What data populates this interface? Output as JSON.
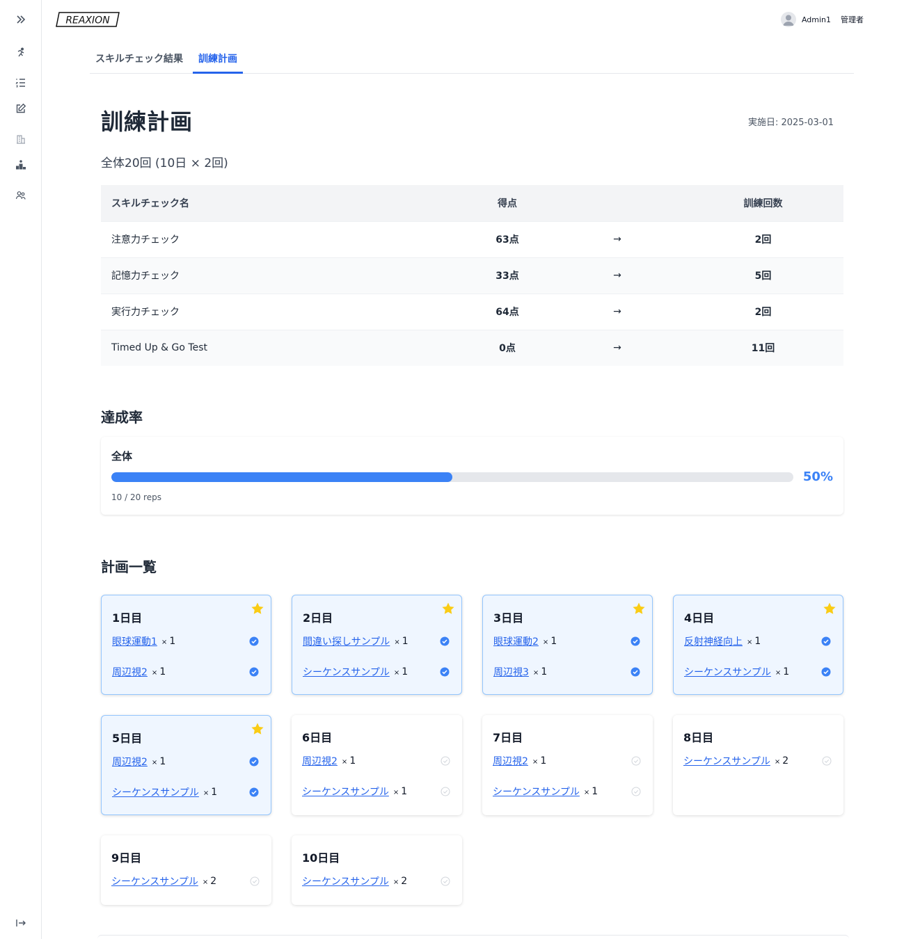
{
  "app": {
    "logo_text": "REAXION",
    "user": {
      "name": "Admin1",
      "role": "管理者"
    }
  },
  "sidebar": {
    "icons": [
      "expand-icon",
      "runner-icon",
      "list-icon",
      "edit-icon",
      "building-icon",
      "podium-icon",
      "users-icon",
      "logout-icon"
    ]
  },
  "tabs": [
    {
      "label": "スキルチェック結果",
      "active": false
    },
    {
      "label": "訓練計画",
      "active": true
    }
  ],
  "page": {
    "title": "訓練計画",
    "exec_date": "実施日: 2025-03-01",
    "summary": "全体20回 (10日 × 2回)"
  },
  "score_table": {
    "headers": {
      "name": "スキルチェック名",
      "score": "得点",
      "count": "訓練回数"
    },
    "arrow": "→",
    "rows": [
      {
        "name": "注意力チェック",
        "score": "63点",
        "count": "2回"
      },
      {
        "name": "記憶力チェック",
        "score": "33点",
        "count": "5回"
      },
      {
        "name": "実行力チェック",
        "score": "64点",
        "count": "2回"
      },
      {
        "name": "Timed Up & Go Test",
        "score": "0点",
        "count": "11回"
      }
    ]
  },
  "achievement": {
    "section_title": "達成率",
    "label": "全体",
    "percent_text": "50%",
    "fraction": 0.5,
    "reps": "10 / 20 reps"
  },
  "plan": {
    "section_title": "計画一覧",
    "days": [
      {
        "title": "1日目",
        "done": true,
        "tasks": [
          {
            "name": "眼球運動1",
            "mult": "1"
          },
          {
            "name": "周辺視2",
            "mult": "1"
          }
        ]
      },
      {
        "title": "2日目",
        "done": true,
        "tasks": [
          {
            "name": "間違い探しサンプル",
            "mult": "1"
          },
          {
            "name": "シーケンスサンプル",
            "mult": "1"
          }
        ]
      },
      {
        "title": "3日目",
        "done": true,
        "tasks": [
          {
            "name": "眼球運動2",
            "mult": "1"
          },
          {
            "name": "周辺視3",
            "mult": "1"
          }
        ]
      },
      {
        "title": "4日目",
        "done": true,
        "tasks": [
          {
            "name": "反射神経向上",
            "mult": "1"
          },
          {
            "name": "シーケンスサンプル",
            "mult": "1"
          }
        ]
      },
      {
        "title": "5日目",
        "done": true,
        "tasks": [
          {
            "name": "周辺視2",
            "mult": "1"
          },
          {
            "name": "シーケンスサンプル",
            "mult": "1"
          }
        ]
      },
      {
        "title": "6日目",
        "done": false,
        "tasks": [
          {
            "name": "周辺視2",
            "mult": "1"
          },
          {
            "name": "シーケンスサンプル",
            "mult": "1"
          }
        ]
      },
      {
        "title": "7日目",
        "done": false,
        "tasks": [
          {
            "name": "周辺視2",
            "mult": "1"
          },
          {
            "name": "シーケンスサンプル",
            "mult": "1"
          }
        ]
      },
      {
        "title": "8日目",
        "done": false,
        "tasks": [
          {
            "name": "シーケンスサンプル",
            "mult": "2"
          }
        ]
      },
      {
        "title": "9日目",
        "done": false,
        "tasks": [
          {
            "name": "シーケンスサンプル",
            "mult": "2"
          }
        ]
      },
      {
        "title": "10日目",
        "done": false,
        "tasks": [
          {
            "name": "シーケンスサンプル",
            "mult": "2"
          }
        ]
      }
    ]
  },
  "colors": {
    "accent": "#2563eb",
    "progress": "#3b82f6",
    "star": "#facc15",
    "done_bg": "#eff6ff"
  }
}
